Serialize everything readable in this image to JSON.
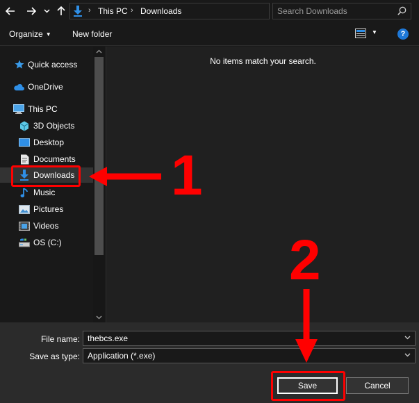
{
  "address_bar": {
    "crumbs": [
      "This PC",
      "Downloads"
    ],
    "search_placeholder": "Search Downloads"
  },
  "toolbar": {
    "organize_label": "Organize",
    "new_folder_label": "New folder",
    "help_label": "?"
  },
  "nav_pane": {
    "items": [
      {
        "label": "Quick access",
        "icon": "star-icon"
      },
      {
        "label": "OneDrive",
        "icon": "cloud-icon"
      },
      {
        "label": "This PC",
        "icon": "computer-icon"
      },
      {
        "label": "3D Objects",
        "icon": "cube-icon"
      },
      {
        "label": "Desktop",
        "icon": "desktop-icon"
      },
      {
        "label": "Documents",
        "icon": "documents-icon"
      },
      {
        "label": "Downloads",
        "icon": "download-icon",
        "selected": true
      },
      {
        "label": "Music",
        "icon": "music-icon"
      },
      {
        "label": "Pictures",
        "icon": "pictures-icon"
      },
      {
        "label": "Videos",
        "icon": "videos-icon"
      },
      {
        "label": "OS (C:)",
        "icon": "drive-icon"
      }
    ]
  },
  "content": {
    "empty_message": "No items match your search."
  },
  "save_panel": {
    "file_name_label": "File name:",
    "file_name_value": "thebcs.exe",
    "save_type_label": "Save as type:",
    "save_type_value": "Application (*.exe)",
    "save_label": "Save",
    "cancel_label": "Cancel"
  },
  "annotations": {
    "step1": "1",
    "step2": "2",
    "color": "#ff0000"
  },
  "colors": {
    "background": "#191919",
    "content_background": "#202020",
    "bottom_panel": "#2b2b2b",
    "accent_blue": "#1e78d7"
  }
}
